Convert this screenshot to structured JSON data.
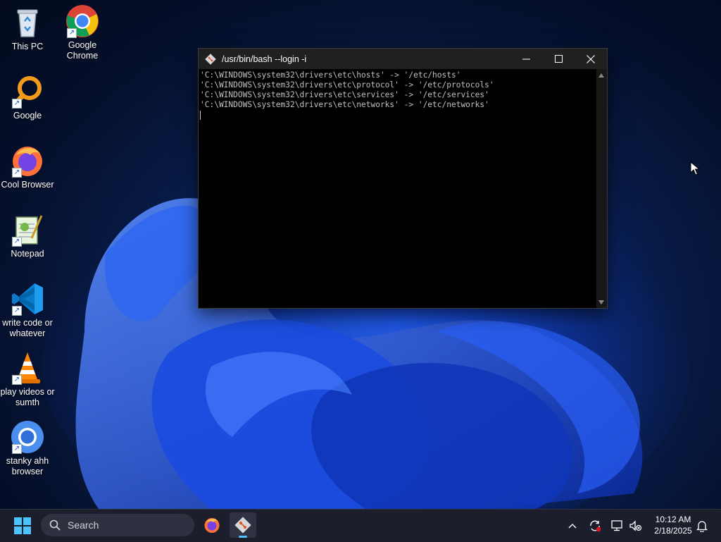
{
  "desktop": {
    "icons": [
      {
        "label": "This PC",
        "icon": "recycle-bin-icon"
      },
      {
        "label": "Google Chrome",
        "icon": "chrome-icon"
      },
      {
        "label": "Google",
        "icon": "magnifier-icon"
      },
      {
        "label": "Cool Browser",
        "icon": "firefox-icon"
      },
      {
        "label": "Notepad",
        "icon": "notepad-icon"
      },
      {
        "label": "write code or whatever",
        "icon": "vscode-icon"
      },
      {
        "label": "play videos or sumth",
        "icon": "vlc-icon"
      },
      {
        "label": "stanky ahh browser",
        "icon": "chromium-icon"
      }
    ]
  },
  "window": {
    "title": "/usr/bin/bash --login -i",
    "terminal_lines": [
      "'C:\\WINDOWS\\system32\\drivers\\etc\\hosts' -> '/etc/hosts'",
      "'C:\\WINDOWS\\system32\\drivers\\etc\\protocol' -> '/etc/protocols'",
      "'C:\\WINDOWS\\system32\\drivers\\etc\\services' -> '/etc/services'",
      "'C:\\WINDOWS\\system32\\drivers\\etc\\networks' -> '/etc/networks'"
    ]
  },
  "taskbar": {
    "search_placeholder": "Search",
    "apps": [
      "firefox-icon",
      "git-bash-icon"
    ],
    "tray_icons": [
      "chevron-up-icon",
      "sync-icon",
      "network-icon",
      "volume-muted-icon",
      "notification-bell-icon"
    ],
    "time": "10:12 AM",
    "date": "2/18/2025"
  },
  "colors": {
    "accent": "#4cc2ff",
    "terminal_bg": "#000000",
    "terminal_text": "#c0c0c0",
    "titlebar_bg": "#202020",
    "taskbar_bg": "#1c1f2b"
  }
}
